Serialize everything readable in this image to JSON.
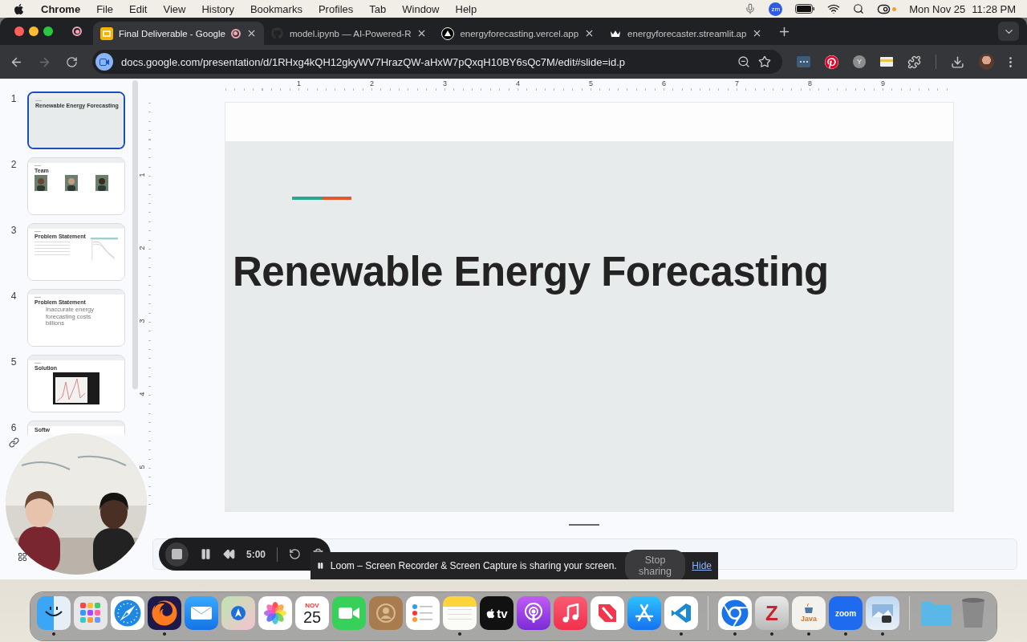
{
  "menu_bar": {
    "app": "Chrome",
    "menus": [
      "File",
      "Edit",
      "View",
      "History",
      "Bookmarks",
      "Profiles",
      "Tab",
      "Window",
      "Help"
    ],
    "zoom_badge": "zm",
    "date": "Mon Nov 25",
    "time": "11:28 PM"
  },
  "browser": {
    "tabs": [
      {
        "title": "Final Deliverable - Google",
        "kind": "slides",
        "recording": true,
        "selected": true
      },
      {
        "title": "model.ipynb — AI-Powered-R",
        "kind": "github",
        "recording": false,
        "selected": false
      },
      {
        "title": "energyforecasting.vercel.app",
        "kind": "triangle",
        "recording": false,
        "selected": false
      },
      {
        "title": "energyforecaster.streamlit.ap",
        "kind": "crown",
        "recording": false,
        "selected": false
      }
    ],
    "back_disabled": false,
    "forward_disabled": true,
    "url": "docs.google.com/presentation/d/1RHxg4kQH12gkyWV7HrazQW-aHxW7pQxqH10BY6sQc7M/edit#slide=id.p",
    "extensions": [
      {
        "kind": "dots"
      },
      {
        "kind": "pinterest"
      },
      {
        "kind": "letter",
        "label": "Y"
      },
      {
        "kind": "card"
      },
      {
        "kind": "puzzle"
      }
    ]
  },
  "filmstrip": [
    {
      "number": "1",
      "selected": true,
      "kind": "title",
      "title": "Renewable Energy Forecasting"
    },
    {
      "number": "2",
      "selected": false,
      "kind": "team",
      "title": "Team"
    },
    {
      "number": "3",
      "selected": false,
      "kind": "chart",
      "title": "Problem Statement"
    },
    {
      "number": "4",
      "selected": false,
      "kind": "statement",
      "title": "Problem Statement",
      "body": "Inaccurate energy forecasting costs billions"
    },
    {
      "number": "5",
      "selected": false,
      "title": "Solution"
    },
    {
      "number": "6",
      "selected": false,
      "kind": "partial",
      "title": "Softw"
    }
  ],
  "ruler": {
    "horizontal": [
      "1",
      "2",
      "3",
      "4",
      "5",
      "6",
      "7",
      "8",
      "9"
    ],
    "vertical": [
      "1",
      "2",
      "3",
      "4",
      "5"
    ]
  },
  "slide": {
    "title": "Renewable Energy Forecasting"
  },
  "loom": {
    "timer": "5:00"
  },
  "sharing_notice": {
    "text": "Loom – Screen Recorder & Screen Capture is sharing your screen.",
    "stop_button": "Stop sharing",
    "hide_link": "Hide"
  },
  "dock": {
    "apps": [
      {
        "kind": "finder",
        "running": true
      },
      {
        "kind": "launchpad",
        "running": false
      },
      {
        "kind": "safari",
        "running": false
      },
      {
        "kind": "firefox",
        "running": true
      },
      {
        "kind": "mail",
        "running": false
      },
      {
        "kind": "maps",
        "running": false
      },
      {
        "kind": "photos",
        "running": false
      },
      {
        "kind": "calendar",
        "month": "NOV",
        "day": "25",
        "running": false
      },
      {
        "kind": "facetime",
        "running": false
      },
      {
        "kind": "contacts",
        "running": false
      },
      {
        "kind": "reminders",
        "running": false
      },
      {
        "kind": "notes",
        "running": true
      },
      {
        "kind": "tv",
        "label": "tv",
        "running": false
      },
      {
        "kind": "podcasts",
        "running": false
      },
      {
        "kind": "music",
        "running": false
      },
      {
        "kind": "news",
        "running": false
      },
      {
        "kind": "appstore",
        "running": false
      },
      {
        "kind": "vscode",
        "running": true
      }
    ],
    "recent": [
      {
        "kind": "chrome",
        "running": true
      },
      {
        "kind": "zotero",
        "label": "Z",
        "running": true
      },
      {
        "kind": "java",
        "label": "Java",
        "running": true
      },
      {
        "kind": "zoom",
        "label": "zoom",
        "running": true
      },
      {
        "kind": "preview",
        "running": true
      }
    ],
    "stacks": [
      {
        "kind": "folder",
        "running": false
      },
      {
        "kind": "trash",
        "running": false
      }
    ]
  }
}
